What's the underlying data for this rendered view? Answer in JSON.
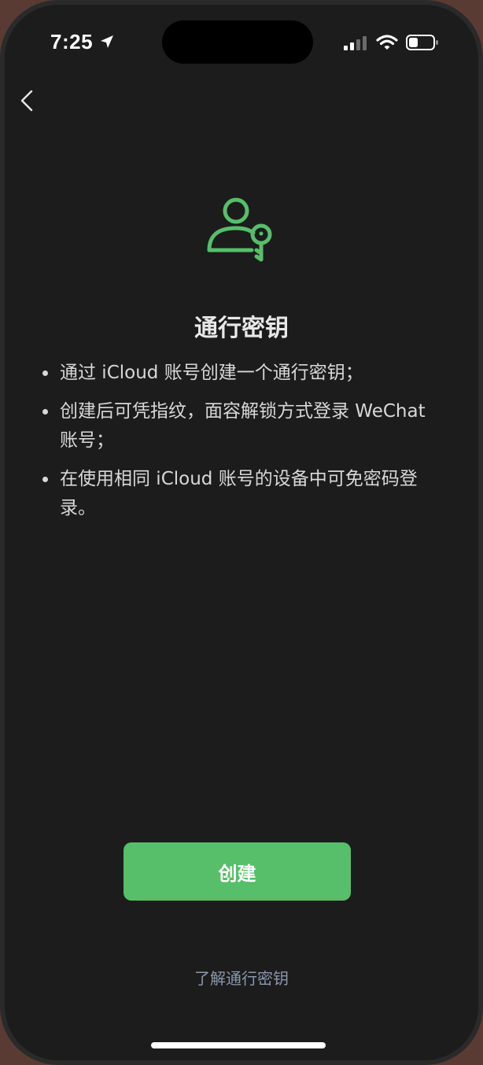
{
  "status_bar": {
    "time": "7:25"
  },
  "nav": {
    "back_icon": "chevron-left-icon"
  },
  "hero": {
    "icon": "passkey-user-key-icon",
    "title": "通行密钥"
  },
  "bullets": [
    "通过 iCloud 账号创建一个通行密钥；",
    "创建后可凭指纹，面容解锁方式登录 WeChat 账号；",
    "在使用相同 iCloud 账号的设备中可免密码登录。"
  ],
  "actions": {
    "create_label": "创建",
    "learn_more_label": "了解通行密钥"
  },
  "colors": {
    "accent": "#57be6a",
    "background": "#1c1c1c",
    "link": "#8a97ad"
  }
}
